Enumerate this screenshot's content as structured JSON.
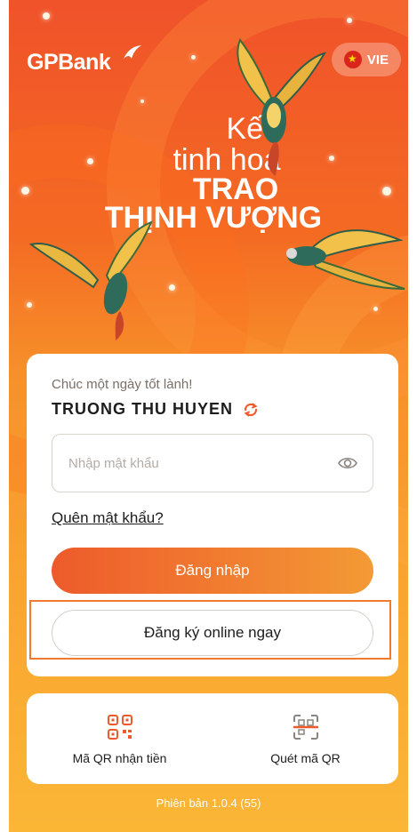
{
  "header": {
    "brand": "GPBank",
    "language": "VIE"
  },
  "slogan": {
    "line1": "Kết",
    "line2": "tinh hoa",
    "line3": "TRAO",
    "line4": "THỊNH VƯỢNG"
  },
  "login": {
    "greeting": "Chúc một ngày tốt lành!",
    "username": "TRUONG THU HUYEN",
    "password_placeholder": "Nhập mật khẩu",
    "forgot_label": "Quên mật khẩu?",
    "login_label": "Đăng nhập",
    "register_label": "Đăng ký online ngay"
  },
  "quick_actions": {
    "items": [
      {
        "label": "Mã QR nhận tiền",
        "icon": "qr-code-icon"
      },
      {
        "label": "Quét mã QR",
        "icon": "qr-scan-icon"
      }
    ]
  },
  "footer": {
    "version": "Phiên bản 1.0.4 (55)"
  },
  "colors": {
    "brand_orange": "#ef5a2b",
    "accent_light": "#fbb636",
    "highlight_border": "#f07a2e"
  }
}
